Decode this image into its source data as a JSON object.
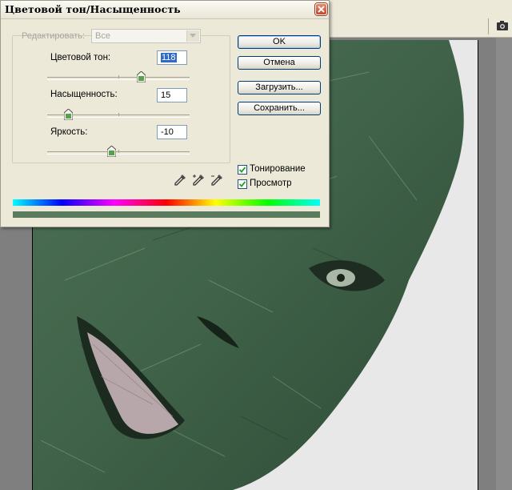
{
  "dialog": {
    "title": "Цветовой тон/Насыщенность",
    "edit_label": "Редактировать:",
    "edit_value": "Все",
    "hue": {
      "label": "Цветовой тон:",
      "value": "118",
      "level": 0.66
    },
    "saturation": {
      "label": "Насыщенность:",
      "value": "15",
      "level": 0.15
    },
    "lightness": {
      "label": "Яркость:",
      "value": "-10",
      "level": 0.45
    },
    "buttons": {
      "ok": "OK",
      "cancel": "Отмена",
      "load": "Загрузить...",
      "save": "Сохранить..."
    },
    "colorize": {
      "label": "Тонирование",
      "checked": true
    },
    "preview": {
      "label": "Просмотр",
      "checked": true
    },
    "result_color": "#5b7b5f"
  },
  "icons": {
    "close": "close-icon",
    "dropdown": "chevron-down-icon",
    "eyedroppers": [
      "eyedropper-icon",
      "eyedropper-plus-icon",
      "eyedropper-minus-icon"
    ],
    "camera": "camera-icon"
  }
}
